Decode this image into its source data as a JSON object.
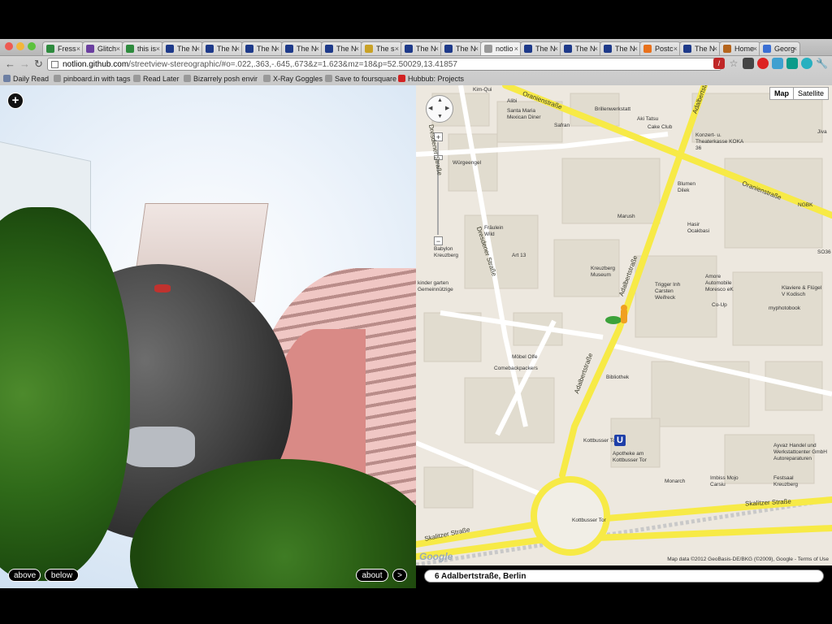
{
  "browser": {
    "tabs": [
      {
        "label": "Fress",
        "fav_color": "#2e8b3e"
      },
      {
        "label": "Glitch",
        "fav_color": "#6b3fa0"
      },
      {
        "label": "this is",
        "fav_color": "#2e8b3e"
      },
      {
        "label": "The N",
        "fav_color": "#1e3a8a"
      },
      {
        "label": "The N",
        "fav_color": "#1e3a8a"
      },
      {
        "label": "The N",
        "fav_color": "#1e3a8a"
      },
      {
        "label": "The N",
        "fav_color": "#1e3a8a"
      },
      {
        "label": "The N",
        "fav_color": "#1e3a8a"
      },
      {
        "label": "The s",
        "fav_color": "#c9a227"
      },
      {
        "label": "The N",
        "fav_color": "#1e3a8a"
      },
      {
        "label": "The N",
        "fav_color": "#1e3a8a"
      },
      {
        "label": "notlio",
        "fav_color": "#999999"
      },
      {
        "label": "The N",
        "fav_color": "#1e3a8a"
      },
      {
        "label": "The N",
        "fav_color": "#1e3a8a"
      },
      {
        "label": "The N",
        "fav_color": "#1e3a8a"
      },
      {
        "label": "Postc",
        "fav_color": "#e8711c"
      },
      {
        "label": "The N",
        "fav_color": "#1e3a8a"
      },
      {
        "label": "Home",
        "fav_color": "#b5651d"
      },
      {
        "label": "Georg",
        "fav_color": "#3b6fd4"
      }
    ],
    "active_tab_index": 11,
    "url_host": "notlion.github.com",
    "url_path": "/streetview-stereographic/#o=.022,.363,-.645,.673&z=1.623&mz=18&p=52.50029,13.41857",
    "bookmarks": [
      {
        "label": "Daily Read",
        "icon_color": "#6d7fa3"
      },
      {
        "label": "pinboard.in with tags",
        "icon_color": "#999999"
      },
      {
        "label": "Read Later",
        "icon_color": "#999999"
      },
      {
        "label": "Bizarrely posh envir",
        "icon_color": "#999999"
      },
      {
        "label": "X-Ray Goggles",
        "icon_color": "#999999"
      },
      {
        "label": "Save to foursquare",
        "icon_color": "#999999"
      },
      {
        "label": "Hubbub: Projects",
        "icon_color": "#d22222"
      }
    ]
  },
  "viewer": {
    "add_icon": "+",
    "buttons": {
      "above": "above",
      "below": "below",
      "about": "about",
      "next": ">"
    }
  },
  "map": {
    "type_map": "Map",
    "type_satellite": "Satellite",
    "zoom_in": "+",
    "zoom_out": "−",
    "streets": {
      "oranien1": "Oranienstraße",
      "oranien2": "Oranienstraße",
      "adalbert1": "Adalbertstraße",
      "adalbert2": "Adalbertstraße",
      "adalbert_top": "Adalbertstr",
      "dresdener1": "Dresdener Straße",
      "dresdener2": "Dresdener Straße",
      "skalitzer1": "Skalitzer Straße",
      "skalitzer2": "Skalitzer Straße"
    },
    "pois": [
      "Kim-Qui",
      "Alibi",
      "Santa Maria Mexican Diner",
      "Safran",
      "Brillenwerkstatt",
      "Aki Tatsu",
      "Cake Club",
      "Konzert- u. Theaterkasse KOKA 36",
      "Blumen Dilek",
      "Würgeengel",
      "Marush",
      "Hasir Ocakbasi",
      "Fräulein Wild",
      "Art 13",
      "Babylon Kreuzberg",
      "Kreuzberg Museum",
      "kinder garten Gemeinnützige",
      "Trigger Inh Carsten Weifreck",
      "Amore Automobile Moresco eK",
      "Klaviere & Flügel V Kodisch",
      "Co-Up",
      "myphotobook",
      "Möbel Olfe",
      "Comebackpackers",
      "Bibliothek",
      "Kottbusser Tor",
      "Apotheke am Kottbusser Tor",
      "Ayvaz Handel und Werkstattcenter GmbH Autoreparaturen",
      "Monarch",
      "Imbiss Mojo Carsiu",
      "Festsaal Kreuzberg",
      "Kottbusser Tor",
      "NGBK",
      "Jiva",
      "SO36"
    ],
    "copyright": "Map data ©2012 GeoBasis-DE/BKG (©2009), Google - Terms of Use",
    "google_logo": "Google",
    "ubahn_letter": "U",
    "address": "6 Adalbertstraße, Berlin"
  }
}
